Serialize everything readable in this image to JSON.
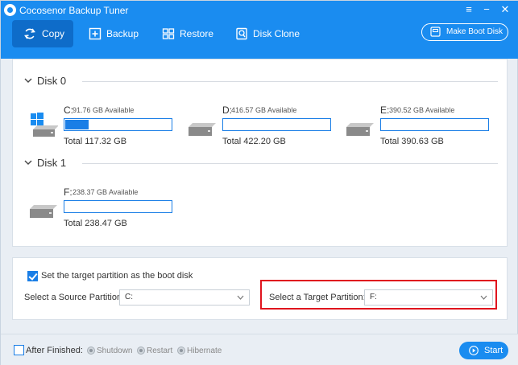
{
  "app": {
    "title": "Cocosenor Backup Tuner"
  },
  "window_controls": [
    "menu-icon",
    "minimize-icon",
    "close-icon"
  ],
  "toolbar": {
    "tabs": [
      {
        "label": "Copy",
        "icon": "copy-icon",
        "active": true
      },
      {
        "label": "Backup",
        "icon": "backup-icon",
        "active": false
      },
      {
        "label": "Restore",
        "icon": "restore-icon",
        "active": false
      },
      {
        "label": "Disk Clone",
        "icon": "disk-clone-icon",
        "active": false
      }
    ],
    "boot_disk_label": "Make Boot Disk"
  },
  "disks": [
    {
      "name": "Disk 0",
      "partitions": [
        {
          "letter": "C:",
          "available": "91.76 GB Available",
          "total": "Total 117.32 GB",
          "used_fraction": 0.22,
          "system": true
        },
        {
          "letter": "D:",
          "available": "416.57 GB Available",
          "total": "Total 422.20 GB",
          "used_fraction": 0.0,
          "system": false
        },
        {
          "letter": "E:",
          "available": "390.52 GB Available",
          "total": "Total 390.63 GB",
          "used_fraction": 0.0,
          "system": false
        }
      ]
    },
    {
      "name": "Disk 1",
      "partitions": [
        {
          "letter": "F:",
          "available": "238.37 GB Available",
          "total": "Total 238.47 GB",
          "used_fraction": 0.0,
          "system": false
        }
      ]
    }
  ],
  "options": {
    "boot_checkbox_label": "Set the target partition as the boot disk",
    "boot_checked": true,
    "source_label": "Select a Source Partition:",
    "source_value": "C:",
    "target_label": "Select a Target Partition:",
    "target_value": "F:"
  },
  "bottom": {
    "after_finished_label": "After Finished:",
    "after_finished_checked": false,
    "radios": [
      "Shutdown",
      "Restart",
      "Hibernate"
    ],
    "start_label": "Start"
  },
  "colors": {
    "accent": "#1a8cf0",
    "highlight": "#e0141e"
  }
}
